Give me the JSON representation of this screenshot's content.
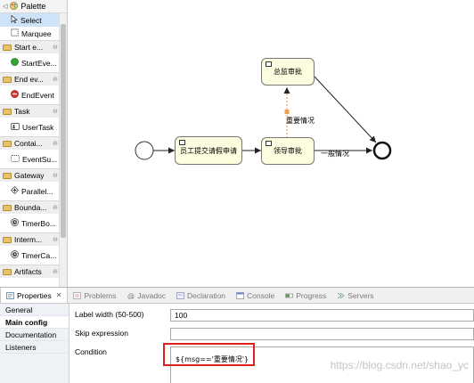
{
  "palette": {
    "title": "Palette",
    "tools": [
      {
        "label": "Select",
        "icon": "select-arrow-icon"
      },
      {
        "label": "Marquee",
        "icon": "marquee-icon"
      }
    ],
    "categories": [
      {
        "label": "Start e...",
        "item": "StartEve...",
        "item_icon": "start-event-icon"
      },
      {
        "label": "End ev...",
        "item": "EndEvent",
        "item_icon": "end-event-icon"
      },
      {
        "label": "Task",
        "item": "UserTask",
        "item_icon": "user-task-icon"
      },
      {
        "label": "Contai...",
        "item": "EventSu...",
        "item_icon": "event-subprocess-icon"
      },
      {
        "label": "Gateway",
        "item": "Parallel...",
        "item_icon": "parallel-gateway-icon"
      },
      {
        "label": "Bounda...",
        "item": "TimerBo...",
        "item_icon": "timer-boundary-icon"
      },
      {
        "label": "Interm...",
        "item": "TimerCa...",
        "item_icon": "timer-catch-icon"
      },
      {
        "label": "Artifacts",
        "item": "",
        "item_icon": ""
      }
    ]
  },
  "diagram": {
    "tasks": {
      "employee": "员工提交请假申请",
      "leader": "领导审批",
      "director": "总监审批"
    },
    "flows": {
      "important": "重要情况",
      "normal": "一般情况"
    },
    "colors": {
      "task_fill": "#fdfde0",
      "selected_flow": "#f0a050"
    }
  },
  "bottom_tabs": [
    {
      "label": "Properties",
      "active": true,
      "icon": "properties-icon"
    },
    {
      "label": "Problems",
      "active": false,
      "icon": "problems-icon"
    },
    {
      "label": "Javadoc",
      "active": false,
      "icon": "javadoc-icon"
    },
    {
      "label": "Declaration",
      "active": false,
      "icon": "declaration-icon"
    },
    {
      "label": "Console",
      "active": false,
      "icon": "console-icon"
    },
    {
      "label": "Progress",
      "active": false,
      "icon": "progress-icon"
    },
    {
      "label": "Servers",
      "active": false,
      "icon": "servers-icon"
    }
  ],
  "properties": {
    "nav": [
      "General",
      "Main config",
      "Documentation",
      "Listeners"
    ],
    "active_nav": "Main config",
    "fields": {
      "label_width_label": "Label width (50-500)",
      "label_width_value": "100",
      "skip_expression_label": "Skip expression",
      "skip_expression_value": "",
      "condition_label": "Condition",
      "condition_value": "${msg=='重要情况'}"
    },
    "highlight_color": "#e0201b"
  },
  "watermark": "https://blog.csdn.net/shao_yc"
}
